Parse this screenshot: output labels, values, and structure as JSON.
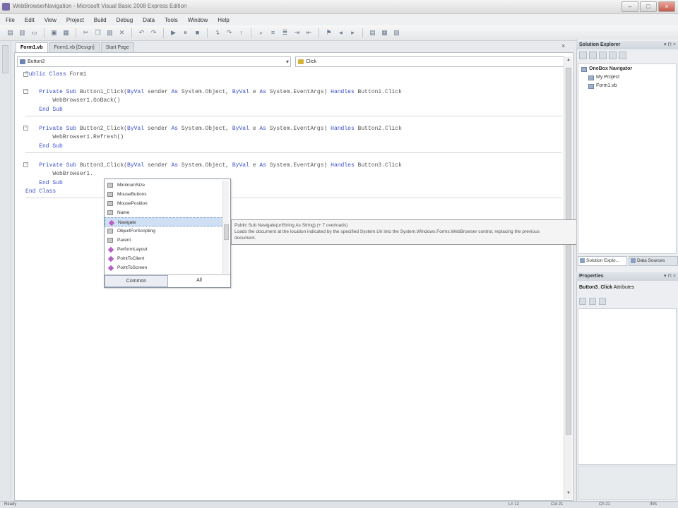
{
  "window": {
    "title": "WebBrowserNavigation - Microsoft Visual Basic 2008 Express Edition"
  },
  "menu": [
    "File",
    "Edit",
    "View",
    "Project",
    "Build",
    "Debug",
    "Data",
    "Tools",
    "Window",
    "Help"
  ],
  "tabs": [
    {
      "label": "Form1.vb",
      "active": true
    },
    {
      "label": "Form1.vb [Design]",
      "active": false
    },
    {
      "label": "Start Page",
      "active": false
    }
  ],
  "editor": {
    "object_combo": "Button3",
    "event_combo": "Click",
    "code_lines": [
      {
        "text": "Public Class Form1"
      },
      {
        "text": ""
      },
      {
        "text": "    Private Sub Button1_Click(ByVal sender As System.Object, ByVal e As System.EventArgs) Handles Button1.Click"
      },
      {
        "text": "        WebBrowser1.GoBack()"
      },
      {
        "text": "    End Sub"
      },
      {
        "text": ""
      },
      {
        "text": "    Private Sub Button2_Click(ByVal sender As System.Object, ByVal e As System.EventArgs) Handles Button2.Click"
      },
      {
        "text": "        WebBrowser1.Refresh()"
      },
      {
        "text": "    End Sub"
      },
      {
        "text": ""
      },
      {
        "text": "    Private Sub Button3_Click(ByVal sender As System.Object, ByVal e As System.EventArgs) Handles Button3.Click"
      },
      {
        "text": "        WebBrowser1."
      },
      {
        "text": "    End Sub"
      },
      {
        "text": "End Class"
      }
    ]
  },
  "intellisense": {
    "items": [
      {
        "label": "MinimumSize",
        "kind": "prop",
        "selected": false
      },
      {
        "label": "MouseButtons",
        "kind": "prop",
        "selected": false
      },
      {
        "label": "MousePosition",
        "kind": "prop",
        "selected": false
      },
      {
        "label": "Name",
        "kind": "prop",
        "selected": false
      },
      {
        "label": "Navigate",
        "kind": "meth",
        "selected": true
      },
      {
        "label": "ObjectForScripting",
        "kind": "prop",
        "selected": false
      },
      {
        "label": "Parent",
        "kind": "prop",
        "selected": false
      },
      {
        "label": "PerformLayout",
        "kind": "meth",
        "selected": false
      },
      {
        "label": "PointToClient",
        "kind": "meth",
        "selected": false
      },
      {
        "label": "PointToScreen",
        "kind": "meth",
        "selected": false
      }
    ],
    "tab_common": "Common",
    "tab_all": "All"
  },
  "tooltip": {
    "line1": "Public Sub Navigate(urlString As String) (+ 7 overloads)",
    "line2": "Loads the document at the location indicated by the specified System.Uri into the System.Windows.Forms.WebBrowser control, replacing the previous",
    "line3": "document."
  },
  "solution_explorer": {
    "title": "Solution Explorer",
    "tree": [
      {
        "label": "OneBox Navigator",
        "bold": true
      },
      {
        "label": "My Project",
        "bold": false
      },
      {
        "label": "Form1.vb",
        "bold": false
      }
    ],
    "tab_solution": "Solution Explo...",
    "tab_data": "Data Sources"
  },
  "properties": {
    "title": "Properties",
    "selected": "Button3_Click",
    "selected_suffix": "Attributes"
  },
  "status": {
    "ready": "Ready",
    "ln": "Ln 12",
    "col": "Col 21",
    "ch": "Ch 21",
    "ins": "INS"
  }
}
